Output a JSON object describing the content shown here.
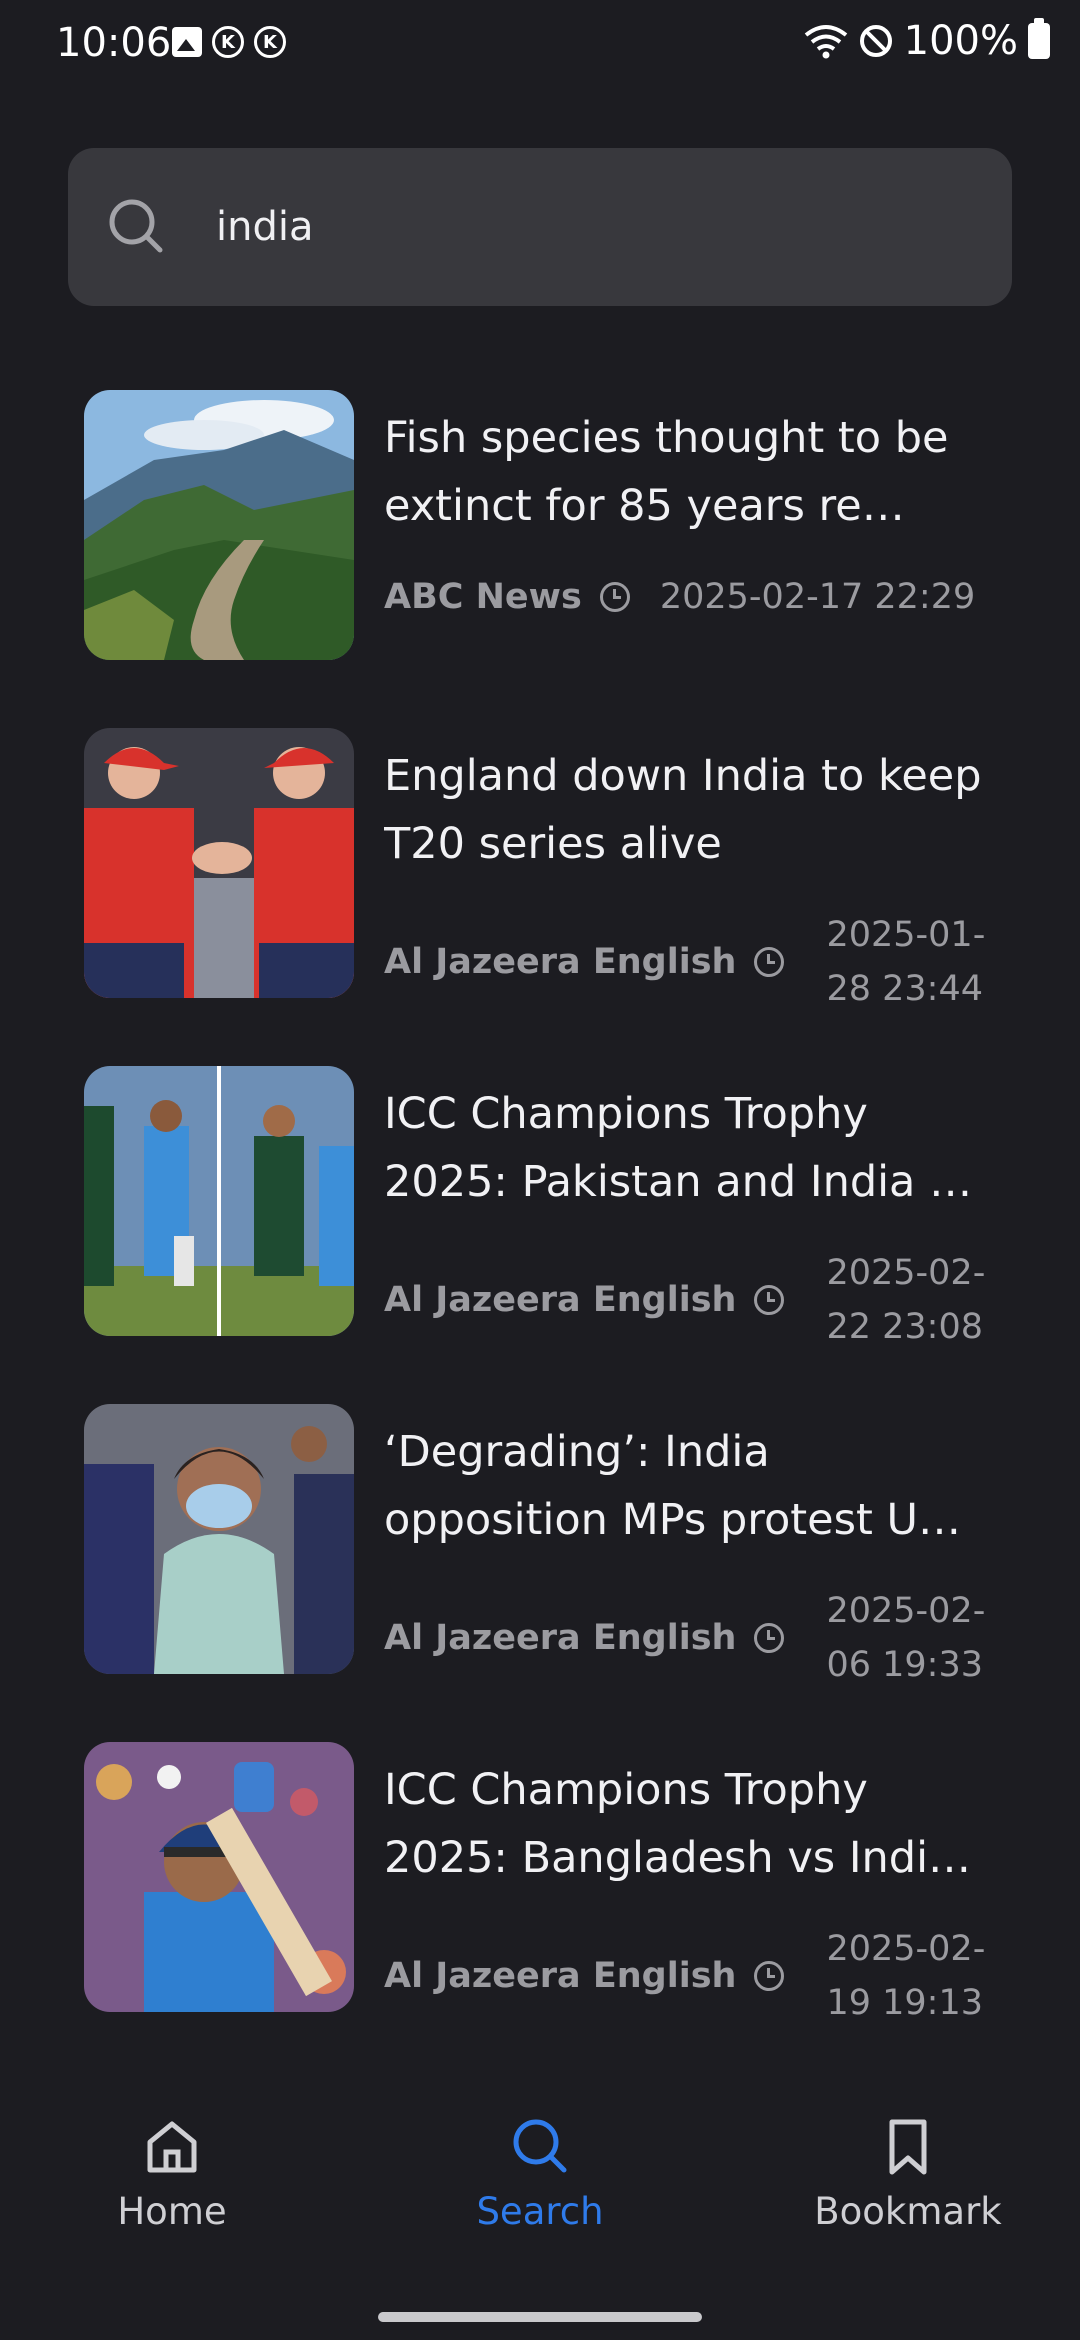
{
  "status_bar": {
    "time": "10:06",
    "battery": "100%",
    "k_label": "K"
  },
  "search": {
    "query": "india",
    "placeholder": ""
  },
  "articles": [
    {
      "title": "Fish species thought to be extinct for 85 years re…",
      "source": "ABC News",
      "date": "2025-02-17 22:29",
      "thumb": "mountain-river-landscape"
    },
    {
      "title": "England down India to keep T20 series alive",
      "source": "Al Jazeera English",
      "date": "2025-01-28 23:44",
      "thumb": "cricketers-handshake"
    },
    {
      "title": "ICC Champions Trophy 2025: Pakistan and India …",
      "source": "Al Jazeera English",
      "date": "2025-02-22 23:08",
      "thumb": "split-cricket-players"
    },
    {
      "title": "‘Degrading’: India opposition MPs protest U…",
      "source": "Al Jazeera English",
      "date": "2025-02-06 19:33",
      "thumb": "woman-wearing-mask"
    },
    {
      "title": "ICC Champions Trophy 2025: Bangladesh vs Indi…",
      "source": "Al Jazeera English",
      "date": "2025-02-19 19:13",
      "thumb": "batsman-playing-shot"
    }
  ],
  "nav": {
    "home": "Home",
    "search": "Search",
    "bookmark": "Bookmark"
  },
  "colors": {
    "accent": "#2f7bea",
    "background": "#1c1c21",
    "search_bg": "#38383d"
  }
}
